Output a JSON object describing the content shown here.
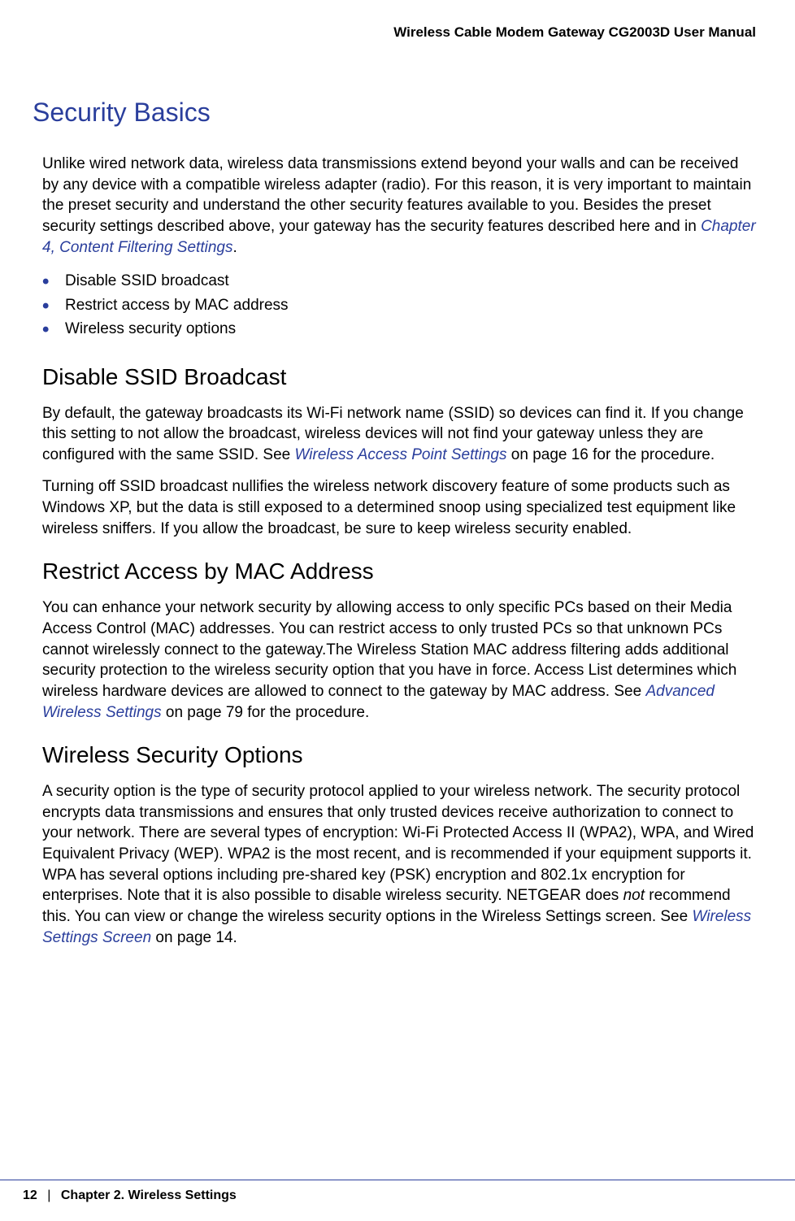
{
  "header": {
    "title": "Wireless Cable Modem Gateway CG2003D User Manual"
  },
  "main_heading": "Security Basics",
  "intro": {
    "text_before_link": "Unlike wired network data, wireless data transmissions extend beyond your walls and can be received by any device with a compatible wireless adapter (radio). For this reason, it is very important to maintain the preset security and understand the other security features available to you. Besides the preset security settings described above, your gateway has the security features described here and in ",
    "link_text": "Chapter 4, Content Filtering Settings",
    "text_after_link": "."
  },
  "bullets": [
    "Disable SSID broadcast",
    "Restrict access by MAC address",
    "Wireless security options"
  ],
  "section1": {
    "heading": "Disable SSID Broadcast",
    "p1_before": "By default, the gateway broadcasts its Wi-Fi network name (SSID) so devices can find it. If you change this setting to not allow the broadcast, wireless devices will not find your gateway unless they are configured with the same SSID. See ",
    "p1_link": "Wireless Access Point Settings",
    "p1_after": " on page 16 for the procedure.",
    "p2": "Turning off SSID broadcast nullifies the wireless network discovery feature of some products such as Windows XP, but the data is still exposed to a determined snoop using specialized test equipment like wireless sniffers. If you allow the broadcast, be sure to keep wireless security enabled."
  },
  "section2": {
    "heading": "Restrict Access by MAC Address",
    "p1_before": "You can enhance your network security by allowing access to only specific PCs based on their Media Access Control (MAC) addresses. You can restrict access to only trusted PCs so that unknown PCs cannot wirelessly connect to the gateway.The Wireless Station MAC address filtering adds additional security protection to the wireless security option that you have in force. Access List determines which wireless hardware devices are allowed to connect to the gateway by MAC address. See ",
    "p1_link": "Advanced Wireless Settings",
    "p1_after": " on page 79 for the procedure."
  },
  "section3": {
    "heading": "Wireless Security Options",
    "p1_before": "A security option is the type of security protocol applied to your wireless network. The security protocol encrypts data transmissions and ensures that only trusted devices receive authorization to connect to your network. There are several types of encryption: Wi-Fi Protected Access II (WPA2), WPA, and Wired Equivalent Privacy (WEP). WPA2 is the most recent, and is recommended if your equipment supports it. WPA has several options including pre-shared key (PSK) encryption and 802.1x encryption for enterprises. Note that it is also possible to disable wireless security. NETGEAR does ",
    "p1_italic": "not",
    "p1_mid": " recommend this. You can view or change the wireless security options in the Wireless Settings screen. See ",
    "p1_link": "Wireless Settings Screen",
    "p1_after": " on page 14."
  },
  "footer": {
    "page_num": "12",
    "separator": "|",
    "chapter": "Chapter 2.  Wireless Settings"
  }
}
